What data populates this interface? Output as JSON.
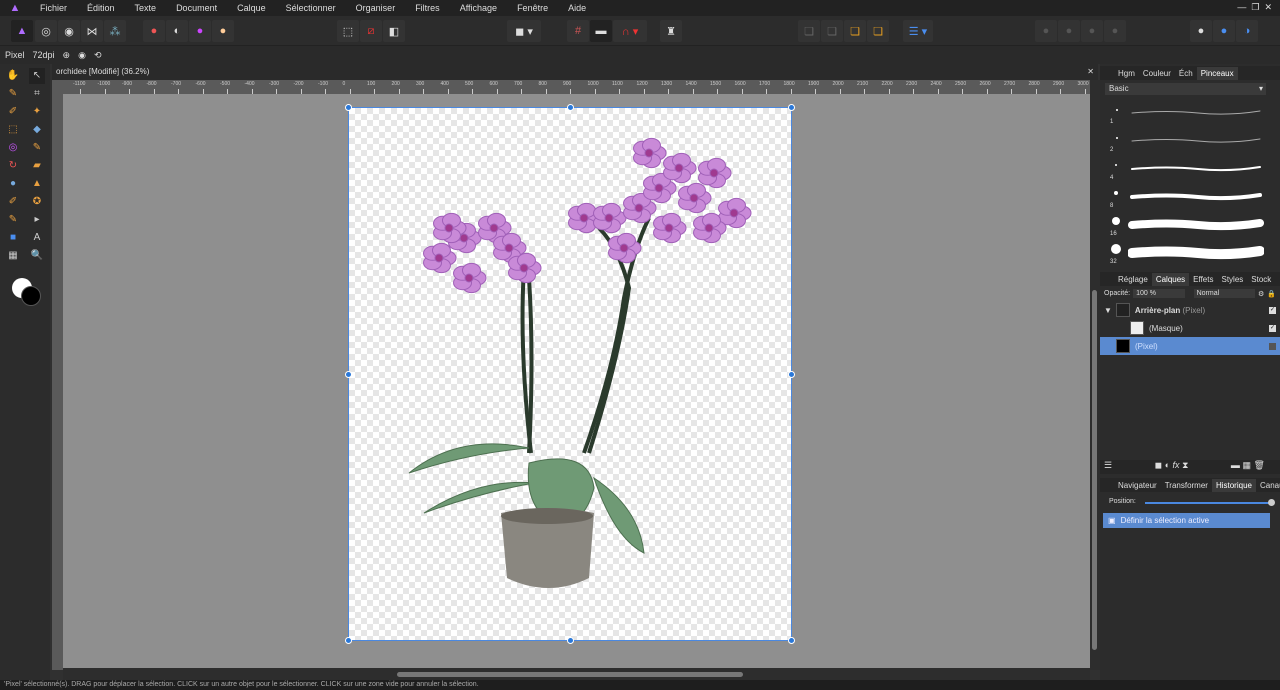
{
  "menu": [
    "Fichier",
    "Édition",
    "Texte",
    "Document",
    "Calque",
    "Sélectionner",
    "Organiser",
    "Filtres",
    "Affichage",
    "Fenêtre",
    "Aide"
  ],
  "context": {
    "unit": "Pixel",
    "dpi": "72dpi"
  },
  "document": {
    "title": "orchidee [Modifié] (36.2%)"
  },
  "ruler": [
    "-1100",
    "-1000",
    "-900",
    "-800",
    "-700",
    "-600",
    "-500",
    "-400",
    "-300",
    "-200",
    "-100",
    "0",
    "100",
    "200",
    "300",
    "400",
    "500",
    "600",
    "700",
    "800",
    "900",
    "1000",
    "1100",
    "1200",
    "1300",
    "1400",
    "1500",
    "1600",
    "1700",
    "1800",
    "1900",
    "2000",
    "2100",
    "2200",
    "2300",
    "2400",
    "2500",
    "2600",
    "2700",
    "2800",
    "2900",
    "3000"
  ],
  "panel_top": {
    "tabs": [
      "Hgm",
      "Couleur",
      "Éch",
      "Pinceaux"
    ],
    "active": 3,
    "category": "Basic",
    "brush_sizes": [
      "1",
      "2",
      "4",
      "8",
      "16",
      "32"
    ]
  },
  "panel_layers": {
    "tabs": [
      "Réglage",
      "Calques",
      "Effets",
      "Styles",
      "Stock"
    ],
    "opacity_label": "Opacité:",
    "opacity": "100 %",
    "blend": "Normal",
    "layers": [
      {
        "name": "Arrière-plan",
        "type": "(Pixel)"
      },
      {
        "name": "(Masque)",
        "type": ""
      },
      {
        "name": "(Pixel)",
        "type": ""
      }
    ]
  },
  "panel_history": {
    "tabs": [
      "Navigateur",
      "Transformer",
      "Historique",
      "Canaux"
    ],
    "position_label": "Position:",
    "position": 1.0,
    "items": [
      "Définir la sélection active"
    ]
  },
  "status": "'Pixel' sélectionné(s). DRAG pour déplacer la sélection. CLICK sur un autre objet pour le sélectionner. CLICK sur une zone vide pour annuler la sélection."
}
